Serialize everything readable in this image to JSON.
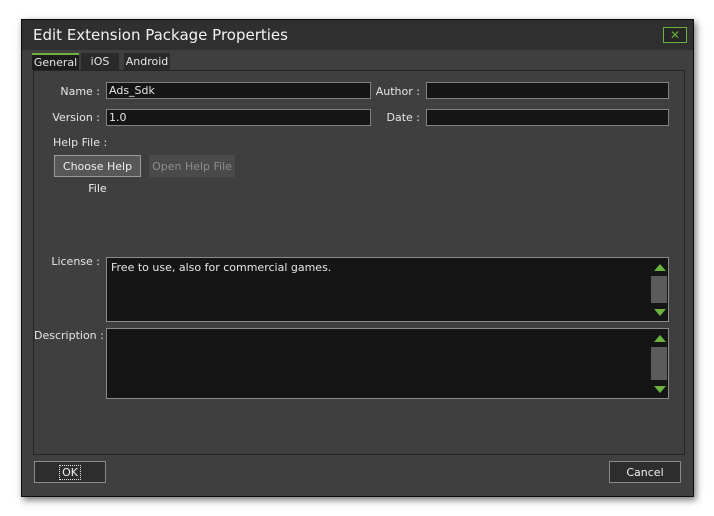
{
  "window": {
    "title": "Edit Extension Package Properties",
    "close_icon": "close-icon"
  },
  "tabs": [
    {
      "label": "General",
      "active": true
    },
    {
      "label": "iOS",
      "active": false
    },
    {
      "label": "Android",
      "active": false
    }
  ],
  "general": {
    "name_label": "Name :",
    "name_value": "Ads_Sdk",
    "author_label": "Author :",
    "author_value": "",
    "version_label": "Version :",
    "version_value": "1.0",
    "date_label": "Date :",
    "date_value": "",
    "help_file_label": "Help File :",
    "choose_help_file": "Choose Help File",
    "open_help_file": "Open Help File",
    "license_label": "License :",
    "license_value": "Free to use, also for commercial games.",
    "description_label": "Description :",
    "description_value": ""
  },
  "footer": {
    "ok_label": "OK",
    "cancel_label": "Cancel"
  },
  "colors": {
    "accent": "#6bb33e",
    "background": "#3f3f3f",
    "field": "#151515"
  }
}
